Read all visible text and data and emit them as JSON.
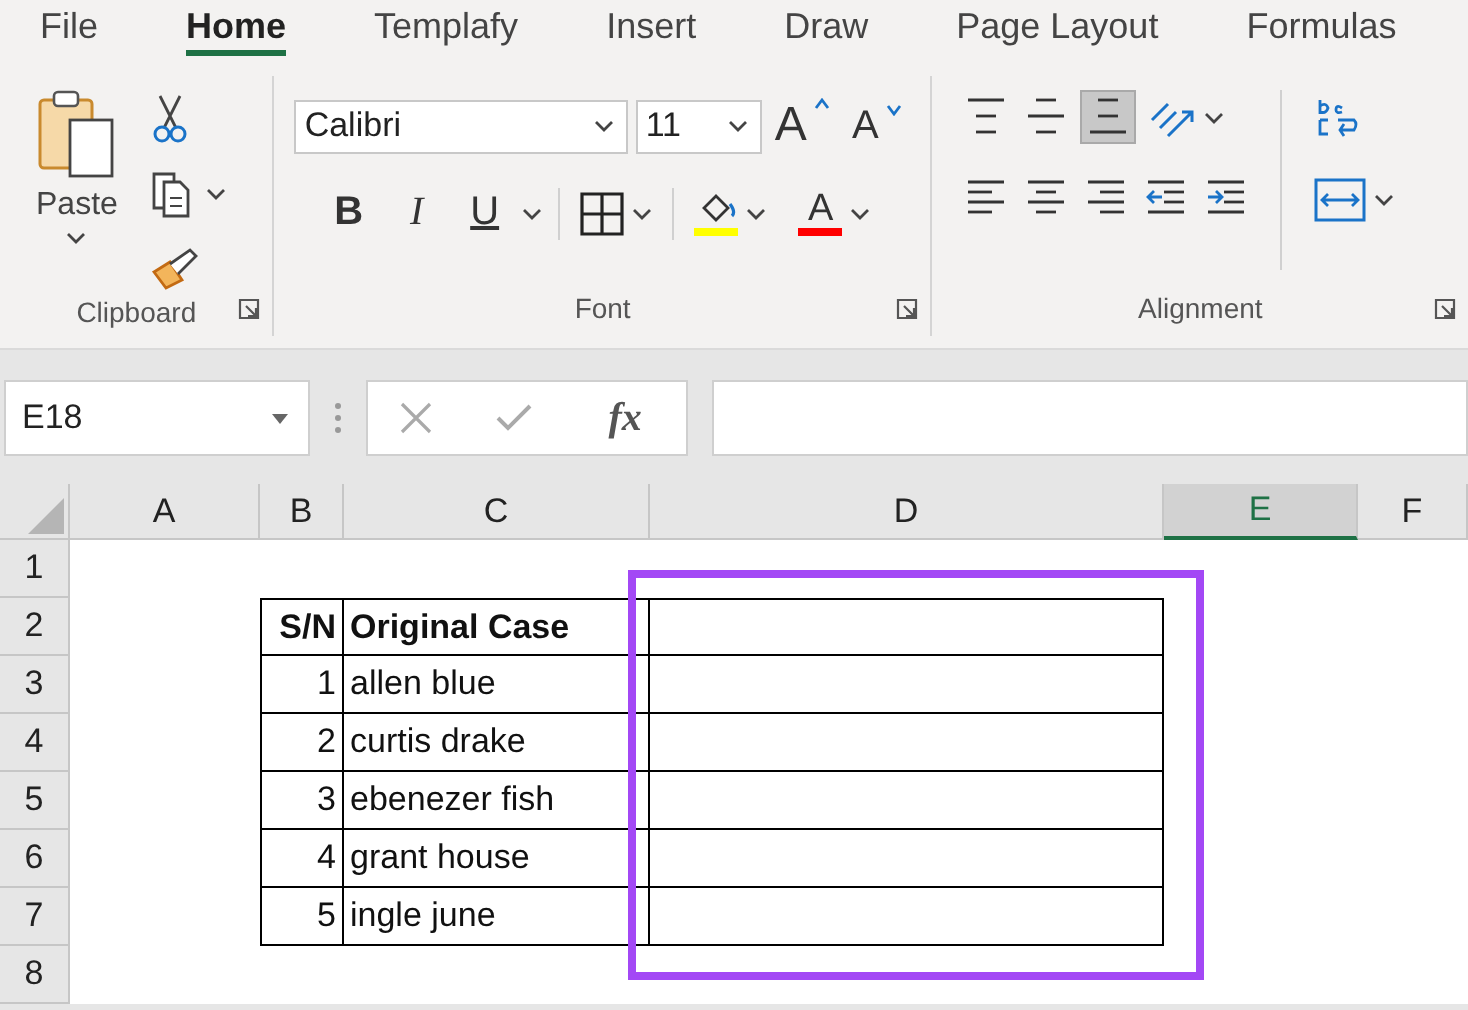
{
  "tabs": [
    {
      "label": "File",
      "selected": false
    },
    {
      "label": "Home",
      "selected": true
    },
    {
      "label": "Templafy",
      "selected": false
    },
    {
      "label": "Insert",
      "selected": false
    },
    {
      "label": "Draw",
      "selected": false
    },
    {
      "label": "Page Layout",
      "selected": false
    },
    {
      "label": "Formulas",
      "selected": false
    }
  ],
  "ribbon": {
    "clipboard": {
      "label": "Clipboard",
      "paste": "Paste"
    },
    "font": {
      "label": "Font",
      "font_name": "Calibri",
      "font_size": "11",
      "grow_glyph": "A",
      "shrink_glyph": "A",
      "font_color_glyph": "A",
      "format_buttons": [
        {
          "kind": "bold",
          "glyph": "B"
        },
        {
          "kind": "italic",
          "glyph": "I"
        },
        {
          "kind": "underline",
          "glyph": "U"
        }
      ]
    },
    "alignment": {
      "label": "Alignment",
      "vertical": [
        {
          "kind": "top",
          "selected": false
        },
        {
          "kind": "middle",
          "selected": false
        },
        {
          "kind": "bottom",
          "selected": true
        }
      ],
      "horizontal": [
        {
          "kind": "left",
          "selected": false
        },
        {
          "kind": "center",
          "selected": false
        },
        {
          "kind": "right",
          "selected": false
        },
        {
          "kind": "outdent",
          "selected": false
        },
        {
          "kind": "indent",
          "selected": false
        }
      ]
    }
  },
  "formula_bar": {
    "name_box": "E18",
    "function_label": "fx"
  },
  "sheet": {
    "columns": [
      {
        "label": "A",
        "selected": false
      },
      {
        "label": "B",
        "selected": false
      },
      {
        "label": "C",
        "selected": false
      },
      {
        "label": "D",
        "selected": false
      },
      {
        "label": "E",
        "selected": true
      },
      {
        "label": "F",
        "selected": false
      }
    ],
    "rows": [
      "1",
      "2",
      "3",
      "4",
      "5",
      "6",
      "7",
      "8"
    ],
    "table": {
      "header": [
        "S/N",
        "Original Case"
      ],
      "rows": [
        {
          "sn": "1",
          "name": "allen blue"
        },
        {
          "sn": "2",
          "name": "curtis drake"
        },
        {
          "sn": "3",
          "name": "ebenezer fish"
        },
        {
          "sn": "4",
          "name": "grant house"
        },
        {
          "sn": "5",
          "name": "ingle june"
        }
      ]
    }
  }
}
